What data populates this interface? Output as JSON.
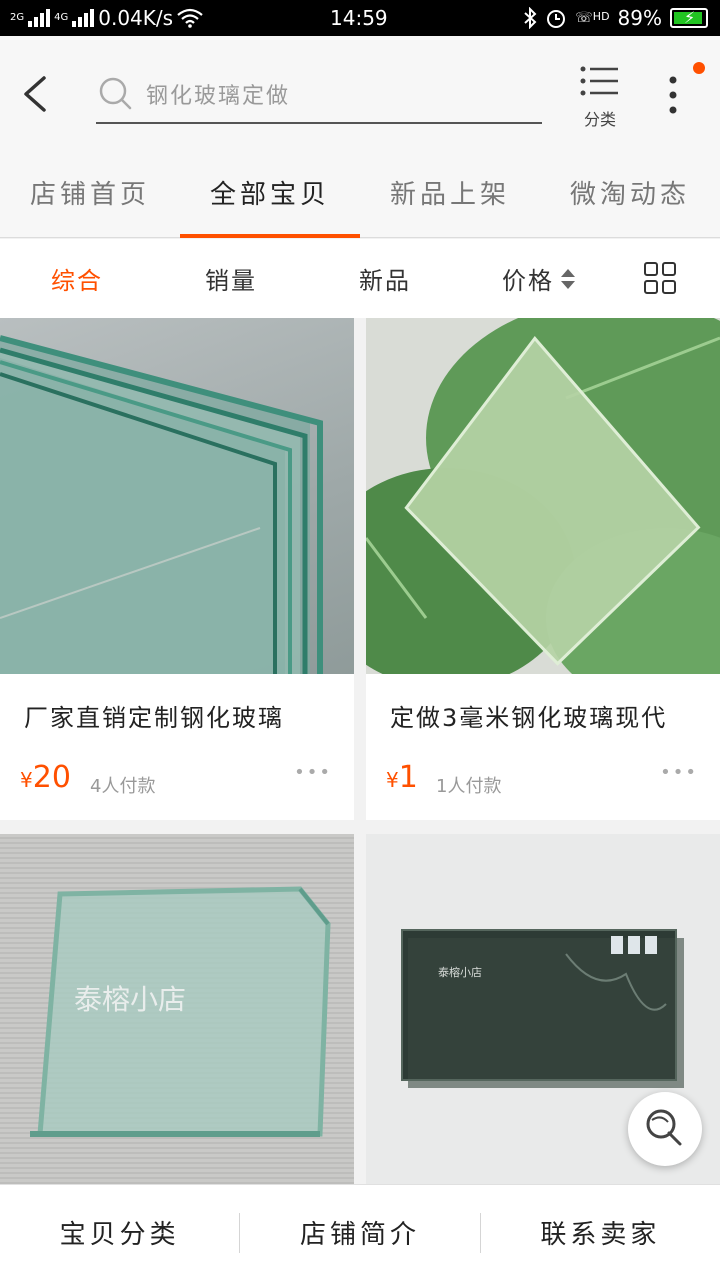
{
  "status_bar": {
    "network_1": "2G",
    "network_2": "4G",
    "speed": "0.04K/s",
    "time": "14:59",
    "battery": "89%",
    "hd": "HD"
  },
  "header": {
    "search_placeholder": "钢化玻璃定做",
    "category_label": "分类"
  },
  "tabs": [
    "店铺首页",
    "全部宝贝",
    "新品上架",
    "微淘动态"
  ],
  "sort": {
    "items": [
      "综合",
      "销量",
      "新品",
      "价格"
    ],
    "active_index": 0
  },
  "products": [
    {
      "title": "厂家直销定制钢化玻璃",
      "currency": "¥",
      "price": "20",
      "sold": "4人付款"
    },
    {
      "title": "定做3毫米钢化玻璃现代",
      "currency": "¥",
      "price": "1",
      "sold": "1人付款"
    },
    {
      "title": "",
      "watermark": "泰榕小店"
    },
    {
      "title": "",
      "watermark": "泰榕小店"
    }
  ],
  "bottom_bar": [
    "宝贝分类",
    "店铺简介",
    "联系卖家"
  ],
  "colors": {
    "accent": "#ff5000",
    "battery": "#22c422"
  }
}
